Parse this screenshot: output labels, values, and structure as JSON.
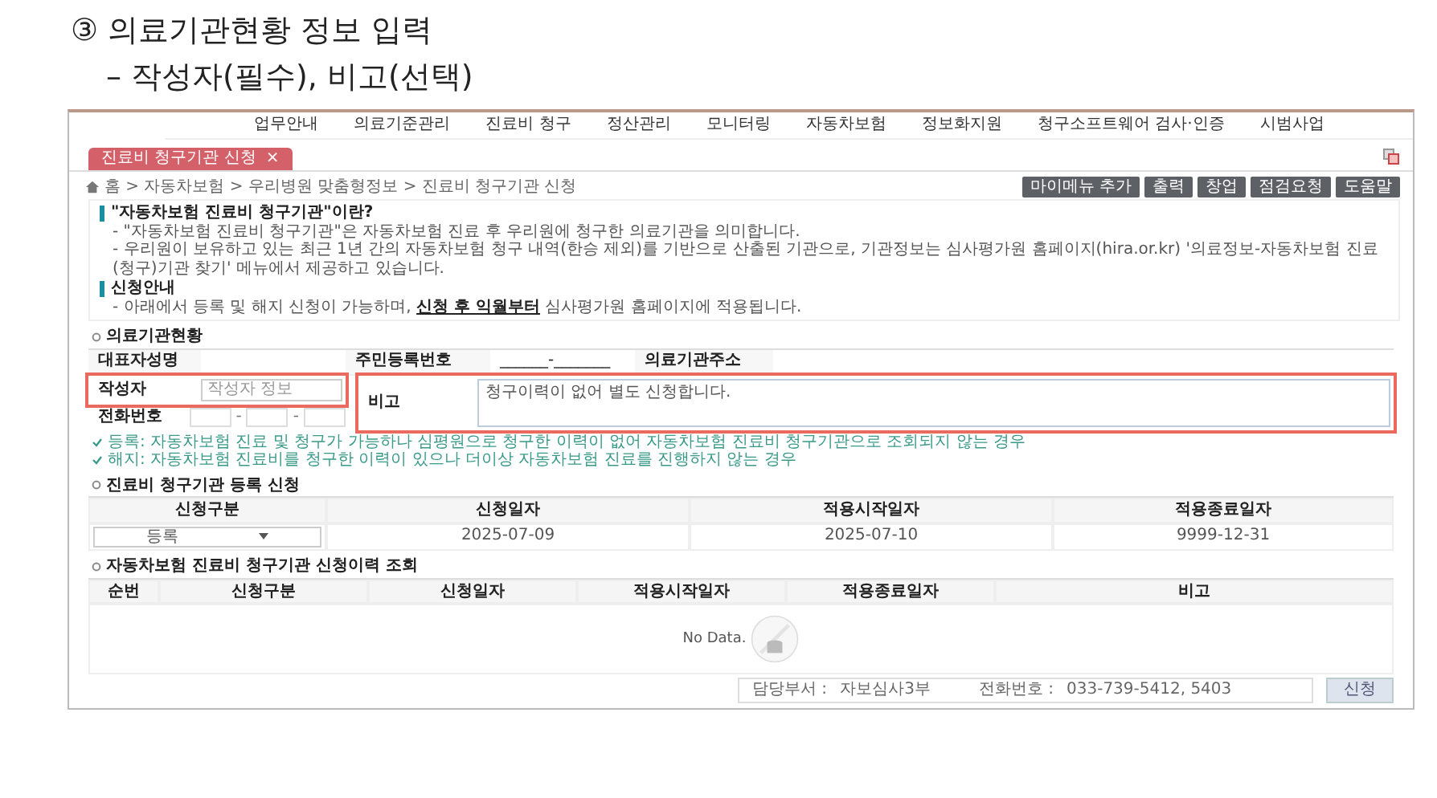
{
  "heading": {
    "title": "③ 의료기관현황 정보 입력",
    "subtitle": "– 작성자(필수), 비고(선택)"
  },
  "nav": [
    "업무안내",
    "의료기준관리",
    "진료비 청구",
    "정산관리",
    "모니터링",
    "자동차보험",
    "정보화지원",
    "청구소프트웨어 검사·인증",
    "시범사업"
  ],
  "tabs": [
    {
      "label": "진료비 청구기관 신청",
      "selected": true,
      "close": "×"
    }
  ],
  "breadcrumb": "홈 > 자동차보험 > 우리병원 맞춤형정보 > 진료비 청구기관 신청",
  "toolbar": [
    "마이메뉴 추가",
    "출력",
    "창업",
    "점검요청",
    "도움말"
  ],
  "info": [
    {
      "kind": "heading",
      "text": "\"자동차보험 진료비 청구기관\"이란?"
    },
    {
      "kind": "item",
      "text": "- \"자동차보험 진료비 청구기관\"은 자동차보험 진료 후 우리원에 청구한 의료기관을 의미합니다."
    },
    {
      "kind": "item",
      "text": "- 우리원이 보유하고 있는 최근 1년 간의 자동차보험 청구 내역(한승 제외)를 기반으로 산출된 기관으로, 기관정보는 심사평가원 홈페이지(hira.or.kr) '의료정보-자동차보험 진료(청구)기관 찾기' 메뉴에서 제공하고 있습니다."
    },
    {
      "kind": "heading",
      "text": "신청안내"
    },
    {
      "kind": "item",
      "text": "- 아래에서 등록 및 해지 신청이 가능하며, **신청 후 익월부터** 심사평가원 홈페이지에 적용됩니다."
    }
  ],
  "institution": {
    "title": "의료기관현황",
    "representative": {
      "label": "대표자성명"
    },
    "rrn": {
      "label": "주민등록번호",
      "value": "______-_______"
    },
    "address": {
      "label": "의료기관주소"
    },
    "writer": {
      "label": "작성자",
      "placeholder": "작성자 정보",
      "highlighted": true
    },
    "remark": {
      "label": "비고",
      "value": "청구이력이 없어 별도 신청합니다.",
      "highlighted": true
    },
    "phone": {
      "label": "전화번호",
      "separators": [
        "-",
        "-"
      ]
    }
  },
  "notes": [
    "등록: 자동차보험 진료 및 청구가 가능하나 심평원으로 청구한 이력이 없어 자동차보험 진료비 청구기관으로 조회되지 않는 경우",
    "해지: 자동차보험 진료비를 청구한 이력이 있으나 더이상 자동차보험 진료를 진행하지 않는 경우"
  ],
  "registration": {
    "title": "진료비 청구기관 등록 신청",
    "columns": [
      "신청구분",
      "신청일자",
      "적용시작일자",
      "적용종료일자"
    ],
    "row": [
      {
        "kind": "select",
        "text": "등록"
      },
      {
        "kind": "text",
        "text": "2025-07-09"
      },
      {
        "kind": "text",
        "text": "2025-07-10"
      },
      {
        "kind": "text",
        "text": "9999-12-31"
      }
    ]
  },
  "history": {
    "title": "자동차보험 진료비 청구기관 신청이력 조회",
    "columns": [
      "순번",
      "신청구분",
      "신청일자",
      "적용시작일자",
      "적용종료일자",
      "비고"
    ],
    "empty": "No Data."
  },
  "submit": "신청",
  "footer": [
    {
      "label": "담당부서 :",
      "value": "자보심사3부"
    },
    {
      "label": "전화번호 :",
      "value": "033-739-5412, 5403"
    }
  ]
}
